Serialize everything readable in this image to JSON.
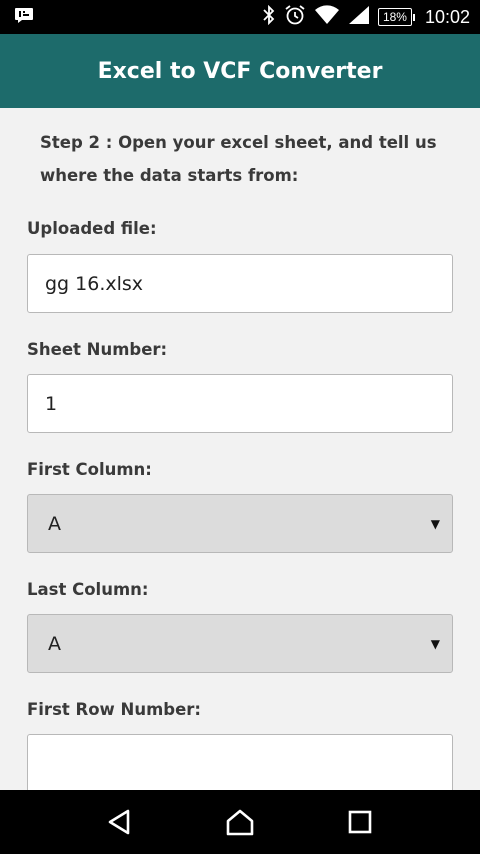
{
  "status_bar": {
    "time": "10:02",
    "battery_percent": "18%",
    "icons": [
      "notification-icon",
      "bluetooth-icon",
      "alarm-icon",
      "wifi-icon",
      "signal-icon",
      "battery-icon"
    ]
  },
  "app_bar": {
    "title": "Excel to VCF Converter",
    "color": "#1d6b6b"
  },
  "form": {
    "step_text": "Step 2 : Open your excel sheet, and tell us where the data starts from:",
    "uploaded_file": {
      "label": "Uploaded file:",
      "value": "gg 16.xlsx"
    },
    "sheet_number": {
      "label": "Sheet Number:",
      "value": "1"
    },
    "first_column": {
      "label": "First Column:",
      "value": "A"
    },
    "last_column": {
      "label": "Last Column:",
      "value": "A"
    },
    "first_row_number": {
      "label": "First Row Number:",
      "value": ""
    }
  },
  "nav_bar": {
    "buttons": [
      "back-icon",
      "home-icon",
      "recents-icon"
    ]
  }
}
